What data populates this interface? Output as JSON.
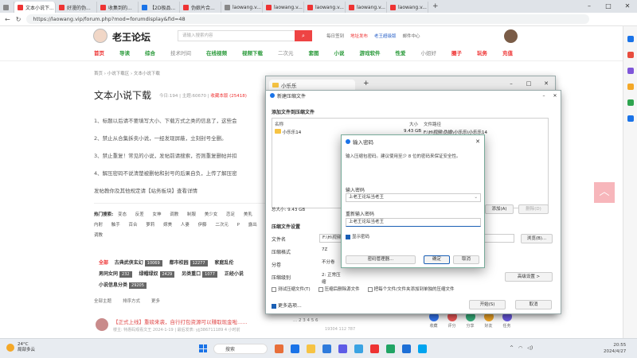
{
  "browser": {
    "tabs": [
      {
        "label": "文本小说下...",
        "active": true
      },
      {
        "label": "好漫的伪..."
      },
      {
        "label": "收集到的..."
      },
      {
        "label": "【2D极品..."
      },
      {
        "label": "伪娘片合..."
      },
      {
        "label": "laowang.v..."
      },
      {
        "label": "laowang.v..."
      },
      {
        "label": "laowang.v..."
      },
      {
        "label": "laowang.v..."
      },
      {
        "label": "laowang.v..."
      }
    ],
    "new_tab": "+",
    "url": "https://laowang.vip/forum.php?mod=forumdisplay&fid=48"
  },
  "site": {
    "logo": "老王论坛",
    "search_placeholder": "请输入搜索内容",
    "top_links": [
      "每日签到",
      "地址发布",
      "老王超级版",
      "邮件中心"
    ],
    "nav": [
      "首页",
      "导读",
      "综合",
      "技术时间",
      "在线视频",
      "视频下载",
      "二次元",
      "套图",
      "小说",
      "游戏软件",
      "性爱",
      "小姐好",
      "圈子",
      "玩务",
      "充值"
    ],
    "breadcrumb": "首页 › 小说下载区 › 文本小说下载",
    "forum_title": "文本小说下载",
    "forum_stats_prefix": "今日:194 | 主题:60670 |",
    "forum_stats_rank": "收藏本版 (25418)",
    "rules": [
      "1、标题以后请不要填写大小、下载方式之类的信息了，这些会",
      "2、禁止从合集拆卖小说，一经发现屏蔽，立刻封号全删。",
      "3、禁止重复！常见的小说，发帖前请搜索，否则重复删帖并扣",
      "4、解压密码不说清楚被删帖和封号的后果自负，上传了解压密",
      "发帖教你及其他规定请【站务板块】查看详情"
    ],
    "hot_label": "热门搜索:",
    "hot_terms": [
      "变态",
      "反差",
      "女神",
      "调教",
      "制服",
      "美少女",
      "恋足",
      "美乳",
      "内射",
      "触手",
      "百合",
      "萝莉",
      "嫁美",
      "人妻",
      "伊藤",
      "二次元",
      "P",
      "露出",
      "调教"
    ],
    "categories": [
      {
        "label": "全部",
        "red": true
      },
      {
        "label": "古典武侠玄幻",
        "count": "10069"
      },
      {
        "label": "都市校园",
        "count": "12277"
      },
      {
        "label": "家庭乱伦",
        "count": ""
      },
      {
        "label": "男同女同",
        "count": "232"
      },
      {
        "label": "绿帽绿奴",
        "count": "2429"
      },
      {
        "label": "另类重口",
        "count": "1077"
      },
      {
        "label": "正经小说",
        "count": ""
      },
      {
        "label": "小说信息分类",
        "count": "29205"
      }
    ],
    "filters": [
      "全部主题",
      "排序方式",
      "更多"
    ],
    "thread": {
      "title": "【正式上线】重磅来袭，自行打包资源可以赚取现金啦......",
      "meta": "楼主: 特惠码观看文王  2024-1-19 | 最后发表: yjj386711189 4 小时前",
      "pages": "... 2 3 4 5 6",
      "stats": "19304  112  787"
    },
    "share": [
      "收藏",
      "评分",
      "分享",
      "好友",
      "任务"
    ],
    "share_colors": [
      "#3478f6",
      "#f05a5a",
      "#36b37e",
      "#f4a828",
      "#6c5ce7"
    ]
  },
  "explorer": {
    "tab_label": "小乐乐",
    "new_tab": "+"
  },
  "archive": {
    "title": "新建压缩文件",
    "section_files": "添加文件到压缩文件",
    "col_name": "名称",
    "col_size": "大小",
    "col_path": "文件路径",
    "file_name": "小乐乐14",
    "file_size": "9.43 GB",
    "file_path": "F:\\H\\视频\\伪娘\\小乐乐\\小乐乐14",
    "total": "总大小: 9.43 GB",
    "add_btn": "添加(A)",
    "del_btn": "删除(D)",
    "section_settings": "压缩文件设置",
    "name_label": "文件名",
    "name_value": "F:\\H\\视频",
    "browse_btn": "浏览(B)...",
    "format_label": "压缩格式",
    "format_value": "7Z",
    "split_label": "分卷",
    "split_value": "不分卷",
    "level_label": "压缩级别",
    "level_value": "2: 正常压缩",
    "advanced_btn": "高级设置 >",
    "chk_test": "测试压缩文件(T)",
    "chk_delete": "压缩后删除源文件",
    "chk_each": "把每个文件/文件夹添加到单独的压缩文件",
    "more": "更多选项...",
    "start_btn": "开始(S)",
    "cancel_btn": "取消"
  },
  "password": {
    "title": "输入密码",
    "desc": "输入压缩包密码。建议使用至少 8 位的密码来保证安全性。",
    "label1": "输入密码",
    "value1": "上老王论坛当老王",
    "label2": "重新输入密码",
    "value2": "上老王论坛当老王",
    "show": "显示密码",
    "manager_btn": "密码管理器...",
    "ok_btn": "确定",
    "cancel_btn": "取消"
  },
  "taskbar": {
    "temp": "24°C",
    "weather": "局部多云",
    "search": "搜索",
    "time": "20:55",
    "date": "2024/4/27"
  }
}
